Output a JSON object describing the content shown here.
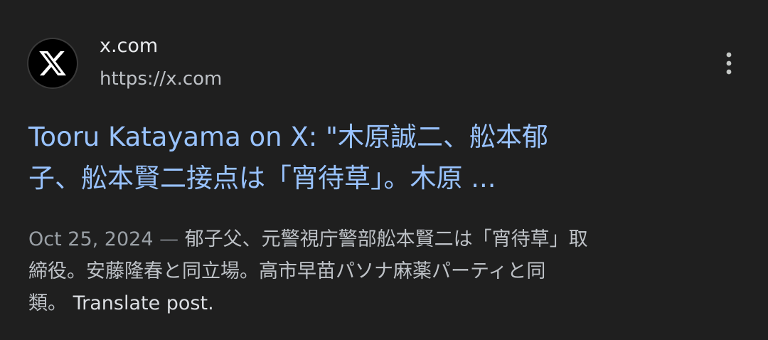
{
  "result": {
    "site_name": "x.com",
    "site_url": "https://x.com",
    "favicon": "x-logo-icon",
    "title_lines": [
      "Tooru Katayama on X: \"木原誠二、舩本郁",
      "子、舩本賢二接点は「宵待草」。木原 ..."
    ],
    "snippet": {
      "date": "Oct 25, 2024",
      "separator": "—",
      "line1_text": "郁子父、元警視庁警部舩本賢二は「宵待草」取",
      "line2_text": "締役。安藤隆春と同立場。高市早苗パソナ麻薬パーティと同",
      "line3_text": "類。",
      "translate_label": "Translate post."
    },
    "more_icon": "more-vert-icon"
  },
  "colors": {
    "background": "#1f1f1f",
    "title_link": "#99c3ff",
    "site_name": "#e8eaed",
    "url": "#bdc1c6",
    "snippet": "#bdc1c6",
    "date": "#9aa0a6"
  }
}
